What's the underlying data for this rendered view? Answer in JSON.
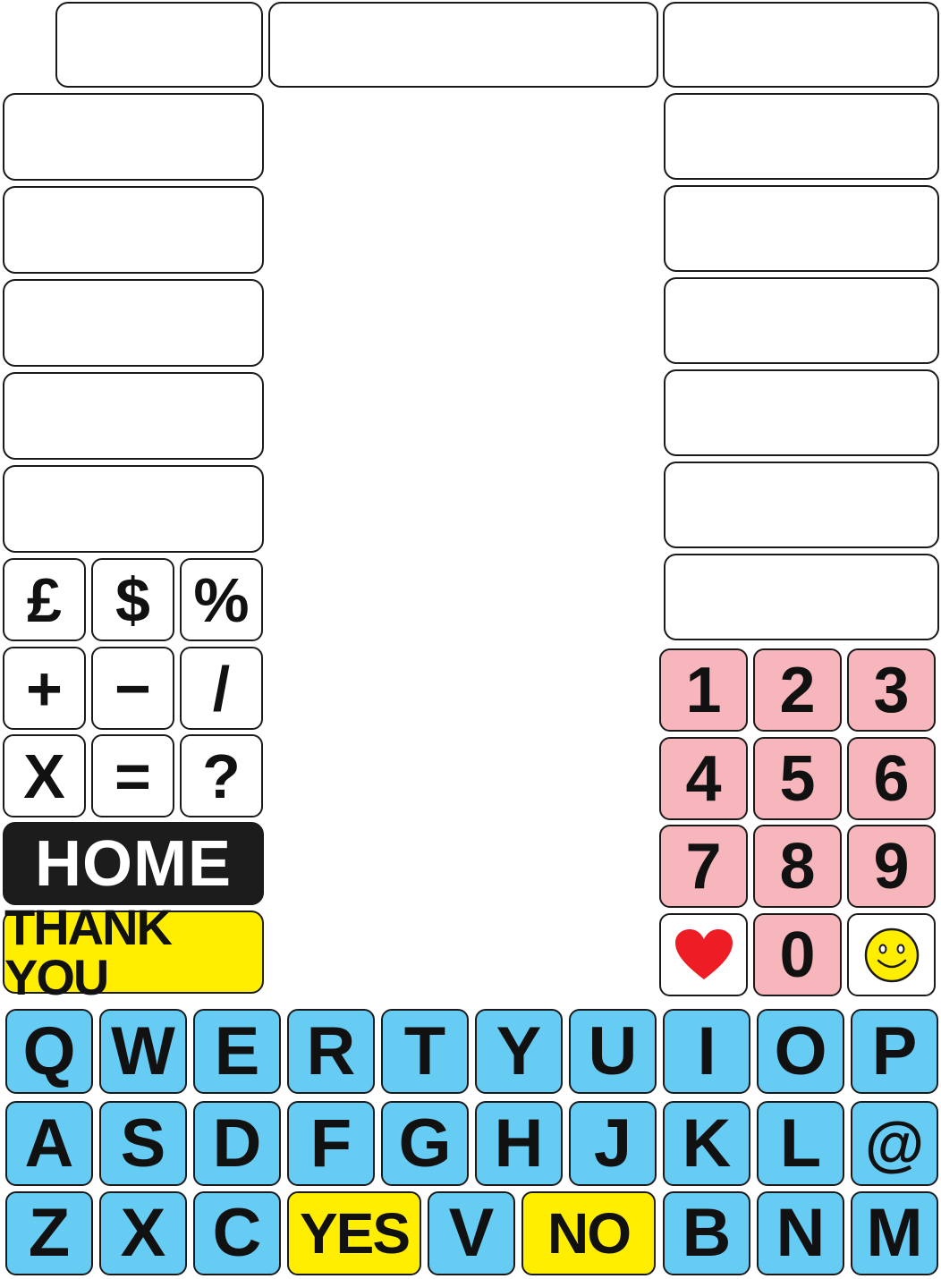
{
  "header_boxes": [
    "",
    "",
    ""
  ],
  "left_boxes": [
    "",
    "",
    "",
    "",
    ""
  ],
  "right_boxes": [
    "",
    "",
    "",
    "",
    "",
    ""
  ],
  "symbols": [
    "£",
    "$",
    "%",
    "+",
    "−",
    "/",
    "X",
    "=",
    "?"
  ],
  "home_label": "HOME",
  "thank_you_label": "THANK YOU",
  "numbers": [
    "1",
    "2",
    "3",
    "4",
    "5",
    "6",
    "7",
    "8",
    "9",
    "0"
  ],
  "icons": {
    "heart": "heart-icon",
    "smiley": "smiley-icon"
  },
  "keyboard": {
    "row1": [
      "Q",
      "W",
      "E",
      "R",
      "T",
      "Y",
      "U",
      "I",
      "O",
      "P"
    ],
    "row2": [
      "A",
      "S",
      "D",
      "F",
      "G",
      "H",
      "J",
      "K",
      "L",
      "@"
    ],
    "row3": [
      "Z",
      "X",
      "C",
      "YES",
      "V",
      "NO",
      "B",
      "N",
      "M"
    ]
  },
  "colors": {
    "alpha_key": "#66ccf4",
    "number_key": "#f6b6bb",
    "yes_no_key": "#ffee00",
    "home_key": "#1c1c1c",
    "heart": "#ee1c24",
    "smiley": "#ffee00"
  }
}
